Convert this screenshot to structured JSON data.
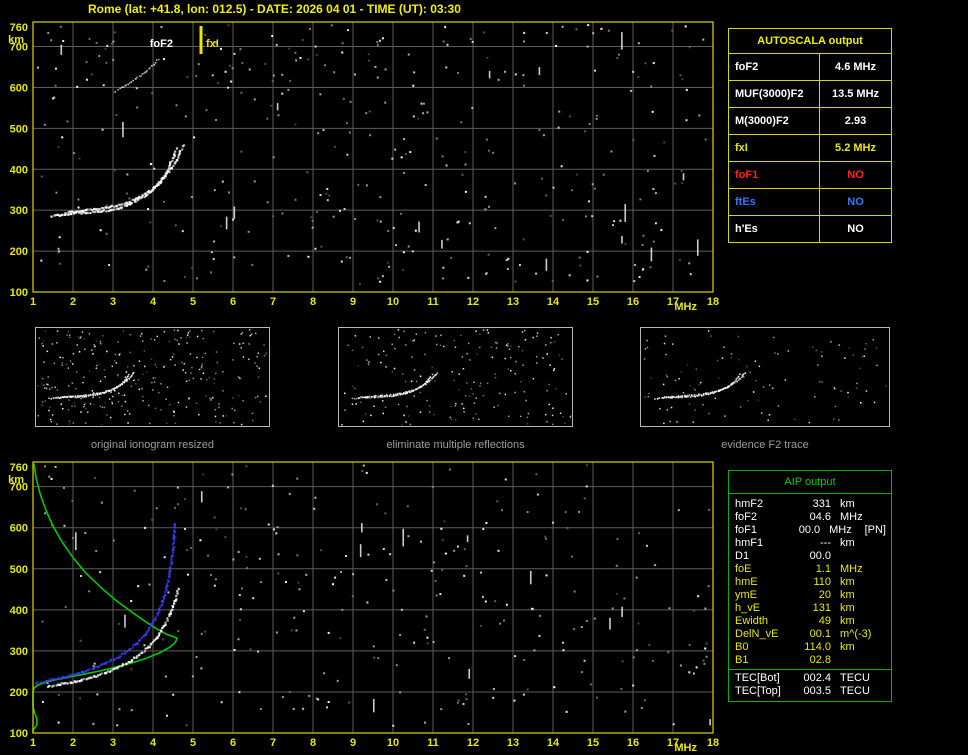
{
  "title": "Rome (lat: +41.8, lon: 012.5) - DATE: 2026 04 01 - TIME (UT): 03:30",
  "colors": {
    "accent_yellow": "#e8e800",
    "accent_green": "#00c800",
    "accent_blue": "#3377ff",
    "accent_red": "#ff2020",
    "grid": "#5c5c5c",
    "noise": "#ffffff",
    "caption_gray": "#9c9c9c"
  },
  "autoscala": {
    "title": "AUTOSCALA output",
    "rows": [
      {
        "label": "foF2",
        "value": "4.6 MHz",
        "color": "#ffffff"
      },
      {
        "label": "MUF(3000)F2",
        "value": "13.5 MHz",
        "color": "#ffffff"
      },
      {
        "label": "M(3000)F2",
        "value": "2.93",
        "color": "#ffffff"
      },
      {
        "label": "fxI",
        "value": "5.2 MHz",
        "color": "#e8e800"
      },
      {
        "label": "foF1",
        "value": "NO",
        "color": "#ff2020"
      },
      {
        "label": "ftEs",
        "value": "NO",
        "color": "#3377ff"
      },
      {
        "label": "h'Es",
        "value": "NO",
        "color": "#ffffff"
      }
    ]
  },
  "aip": {
    "title": "AIP output",
    "rows": [
      {
        "label": "hmF2",
        "value": "331",
        "unit": "km",
        "extra": "",
        "color": "#ffffff",
        "sep": false
      },
      {
        "label": "foF2",
        "value": "04.6",
        "unit": "MHz",
        "extra": "",
        "color": "#ffffff",
        "sep": false
      },
      {
        "label": "foF1",
        "value": "00.0",
        "unit": "MHz",
        "extra": "[PN]",
        "color": "#ffffff",
        "sep": false
      },
      {
        "label": "hmF1",
        "value": "---",
        "unit": "km",
        "extra": "",
        "color": "#ffffff",
        "sep": false
      },
      {
        "label": "D1",
        "value": "00.0",
        "unit": "",
        "extra": "",
        "color": "#ffffff",
        "sep": false
      },
      {
        "label": "foE",
        "value": "1.1",
        "unit": "MHz",
        "extra": "",
        "color": "#e8e800",
        "sep": false
      },
      {
        "label": "hmE",
        "value": "110",
        "unit": "km",
        "extra": "",
        "color": "#e8e800",
        "sep": false
      },
      {
        "label": "ymE",
        "value": "20",
        "unit": "km",
        "extra": "",
        "color": "#e8e800",
        "sep": false
      },
      {
        "label": "h_vE",
        "value": "131",
        "unit": "km",
        "extra": "",
        "color": "#e8e800",
        "sep": false
      },
      {
        "label": "Ewidth",
        "value": "49",
        "unit": "km",
        "extra": "",
        "color": "#e8e800",
        "sep": false
      },
      {
        "label": "DelN_vE",
        "value": "00.1",
        "unit": "m^(-3)",
        "extra": "",
        "color": "#e8e800",
        "sep": false
      },
      {
        "label": "B0",
        "value": "114.0",
        "unit": "km",
        "extra": "",
        "color": "#e8e800",
        "sep": false
      },
      {
        "label": "B1",
        "value": "02.8",
        "unit": "",
        "extra": "",
        "color": "#e8e800",
        "sep": false
      },
      {
        "label": "TEC[Bot]",
        "value": "002.4",
        "unit": "TECU",
        "extra": "",
        "color": "#ffffff",
        "sep": true
      },
      {
        "label": "TEC[Top]",
        "value": "003.5",
        "unit": "TECU",
        "extra": "",
        "color": "#ffffff",
        "sep": false
      }
    ]
  },
  "thumbnails": [
    {
      "caption": "original ionogram resized",
      "noise": 300,
      "seed": 5
    },
    {
      "caption": "eliminate multiple reflections",
      "noise": 190,
      "seed": 17
    },
    {
      "caption": "evidence F2 trace",
      "noise": 110,
      "seed": 23
    }
  ],
  "chart_data": [
    {
      "id": "main_ionogram",
      "type": "scatter",
      "title": "recorded ionogram with scaled characteristics",
      "xlabel": "MHz",
      "ylabel": "km",
      "xlim": [
        1,
        18
      ],
      "ylim": [
        100,
        760
      ],
      "xticks": [
        1,
        2,
        3,
        4,
        5,
        6,
        7,
        8,
        9,
        10,
        11,
        12,
        13,
        14,
        15,
        16,
        17,
        18
      ],
      "yticks": [
        100,
        200,
        300,
        400,
        500,
        600,
        700,
        760
      ],
      "grid": true,
      "frame_color": "#d8d800",
      "annotations": [
        {
          "text": "foF2",
          "f": 4.6,
          "color": "#ffffff",
          "align": "left",
          "line": false
        },
        {
          "text": "fxI",
          "f": 5.2,
          "color": "#e8e800",
          "align": "right",
          "line": true
        }
      ],
      "series": [
        {
          "name": "F2 trace o-mode",
          "color": "#ffffff",
          "dot": 2.2,
          "points": [
            [
              1.45,
              288
            ],
            [
              1.7,
              291
            ],
            [
              2.0,
              294
            ],
            [
              2.3,
              296
            ],
            [
              2.6,
              299
            ],
            [
              2.9,
              303
            ],
            [
              3.15,
              309
            ],
            [
              3.4,
              317
            ],
            [
              3.6,
              327
            ],
            [
              3.8,
              339
            ],
            [
              3.95,
              352
            ],
            [
              4.1,
              366
            ],
            [
              4.22,
              382
            ],
            [
              4.33,
              400
            ],
            [
              4.42,
              419
            ],
            [
              4.5,
              437
            ],
            [
              4.56,
              452
            ]
          ]
        },
        {
          "name": "F2 trace x-mode",
          "color": "#ffffff",
          "dot": 2.2,
          "points": [
            [
              1.8,
              296
            ],
            [
              2.05,
              299
            ],
            [
              2.3,
              302
            ],
            [
              2.55,
              305
            ],
            [
              2.8,
              309
            ],
            [
              3.05,
              314
            ],
            [
              3.3,
              321
            ],
            [
              3.55,
              330
            ],
            [
              3.78,
              342
            ],
            [
              3.98,
              355
            ],
            [
              4.15,
              370
            ],
            [
              4.3,
              387
            ],
            [
              4.44,
              406
            ],
            [
              4.56,
              426
            ],
            [
              4.66,
              446
            ],
            [
              4.74,
              463
            ]
          ]
        },
        {
          "name": "second reflection",
          "color": "#cccccc",
          "dot": 1.6,
          "points": [
            [
              3.05,
              592
            ],
            [
              3.3,
              607
            ],
            [
              3.55,
              622
            ],
            [
              3.8,
              640
            ],
            [
              4.0,
              658
            ],
            [
              4.12,
              672
            ]
          ]
        }
      ],
      "noise": {
        "count": 380,
        "seed": 13
      }
    },
    {
      "id": "profile_plot",
      "type": "scatter",
      "title": "electron density profile and restored trace",
      "xlabel": "MHz",
      "ylabel": "km",
      "xlim": [
        1,
        18
      ],
      "ylim": [
        100,
        760
      ],
      "xticks": [
        1,
        2,
        3,
        4,
        5,
        6,
        7,
        8,
        9,
        10,
        11,
        12,
        13,
        14,
        15,
        16,
        17,
        18
      ],
      "yticks": [
        100,
        200,
        300,
        400,
        500,
        600,
        700,
        760
      ],
      "grid": true,
      "frame_color": "#d8d800",
      "annotations": [],
      "series": [
        {
          "name": "electron density profile",
          "type": "line",
          "color": "#00c800",
          "points": [
            [
              1.02,
              756
            ],
            [
              1.08,
              720
            ],
            [
              1.18,
              682
            ],
            [
              1.32,
              643
            ],
            [
              1.5,
              604
            ],
            [
              1.73,
              565
            ],
            [
              2.0,
              527
            ],
            [
              2.32,
              490
            ],
            [
              2.68,
              456
            ],
            [
              3.06,
              424
            ],
            [
              3.45,
              396
            ],
            [
              3.8,
              372
            ],
            [
              4.1,
              353
            ],
            [
              4.35,
              340
            ],
            [
              4.52,
              334
            ],
            [
              4.6,
              331
            ],
            [
              4.56,
              321
            ],
            [
              4.42,
              309
            ],
            [
              4.18,
              296
            ],
            [
              3.86,
              283
            ],
            [
              3.48,
              271
            ],
            [
              3.06,
              260
            ],
            [
              2.62,
              250
            ],
            [
              2.2,
              242
            ],
            [
              1.84,
              235
            ],
            [
              1.54,
              229
            ],
            [
              1.3,
              223
            ],
            [
              1.13,
              217
            ],
            [
              1.03,
              210
            ],
            [
              0.98,
              201
            ],
            [
              0.96,
              190
            ],
            [
              0.96,
              177
            ],
            [
              0.99,
              163
            ],
            [
              1.04,
              149
            ],
            [
              1.09,
              137
            ],
            [
              1.1,
              128
            ],
            [
              1.09,
              119
            ],
            [
              1.04,
              112
            ],
            [
              0.95,
              107
            ],
            [
              0.8,
              103
            ],
            [
              0.55,
              101
            ],
            [
              0.2,
              100
            ]
          ]
        },
        {
          "name": "restored trace",
          "color": "#3c3cff",
          "dot": 2.2,
          "points": [
            [
              1.05,
              224
            ],
            [
              1.3,
              229
            ],
            [
              1.6,
              235
            ],
            [
              1.9,
              242
            ],
            [
              2.2,
              250
            ],
            [
              2.5,
              260
            ],
            [
              2.8,
              272
            ],
            [
              3.08,
              286
            ],
            [
              3.34,
              302
            ],
            [
              3.58,
              321
            ],
            [
              3.78,
              343
            ],
            [
              3.95,
              367
            ],
            [
              4.1,
              394
            ],
            [
              4.22,
              425
            ],
            [
              4.32,
              459
            ],
            [
              4.4,
              496
            ],
            [
              4.46,
              536
            ],
            [
              4.5,
              576
            ],
            [
              4.53,
              612
            ]
          ]
        },
        {
          "name": "ionogram trace",
          "color": "#ffffff",
          "dot": 2.2,
          "points": [
            [
              1.35,
              216
            ],
            [
              1.6,
              220
            ],
            [
              1.9,
              225
            ],
            [
              2.2,
              231
            ],
            [
              2.5,
              239
            ],
            [
              2.8,
              249
            ],
            [
              3.1,
              261
            ],
            [
              3.38,
              276
            ],
            [
              3.64,
              293
            ],
            [
              3.88,
              313
            ],
            [
              4.08,
              336
            ],
            [
              4.25,
              362
            ],
            [
              4.4,
              392
            ],
            [
              4.52,
              424
            ],
            [
              4.6,
              452
            ]
          ]
        }
      ],
      "noise": {
        "count": 300,
        "seed": 29
      }
    }
  ]
}
